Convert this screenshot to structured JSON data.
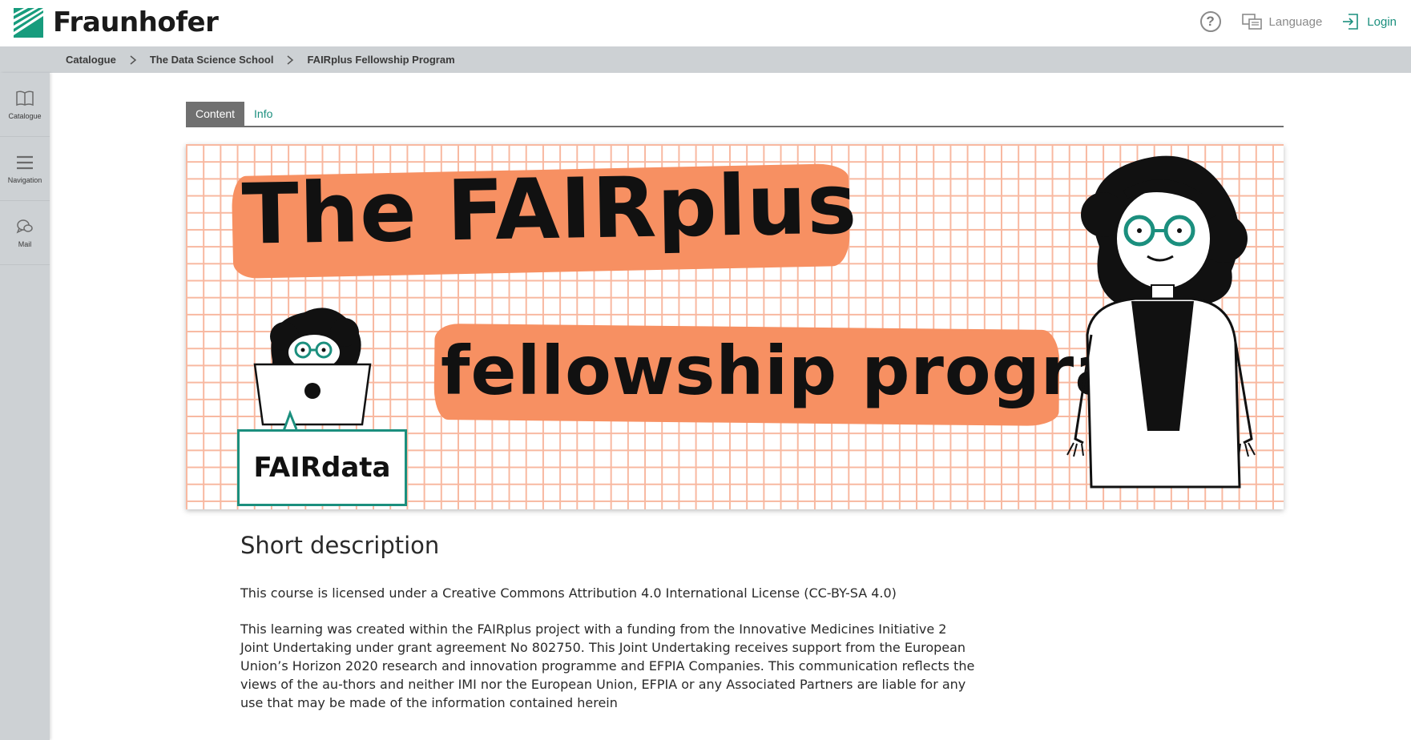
{
  "header": {
    "brand": "Fraunhofer",
    "logo_icon": "fraunhofer-logo-icon",
    "help_icon": "help-icon",
    "help_glyph": "?",
    "language_label": "Language",
    "login_label": "Login"
  },
  "breadcrumb": {
    "items": [
      "Catalogue",
      "The Data Science School"
    ],
    "current": "FAIRplus Fellowship Program"
  },
  "sidebar": {
    "items": [
      {
        "label": "Catalogue",
        "icon": "book-icon"
      },
      {
        "label": "Navigation",
        "icon": "menu-icon"
      },
      {
        "label": "Mail",
        "icon": "chat-icon"
      }
    ]
  },
  "tabs": [
    {
      "label": "Content",
      "active": true
    },
    {
      "label": "Info",
      "active": false
    }
  ],
  "banner": {
    "line1": "The FAIRplus",
    "line2": "fellowship program",
    "badge": "FAIRdata"
  },
  "description": {
    "title": "Short description",
    "paragraphs": [
      "This course is licensed under a Creative Commons Attribution 4.0 International License (CC-BY-SA 4.0)",
      "This learning was created within the FAIRplus project with a funding from the Innovative Medicines Initiative 2 Joint Undertaking under grant agreement No 802750. This Joint Undertaking receives support from the European Union’s Horizon 2020 research and innovation programme and EFPIA Companies. This communication reflects the views of the au-thors and neither IMI nor the European Union, EFPIA or any Associated Partners are liable for any use that may be made of the information contained herein"
    ]
  },
  "colors": {
    "accent": "#1b8f7e",
    "sidebar_bg": "#cdd1d4",
    "brush": "#f79062",
    "grid": "#f8b8a0"
  }
}
